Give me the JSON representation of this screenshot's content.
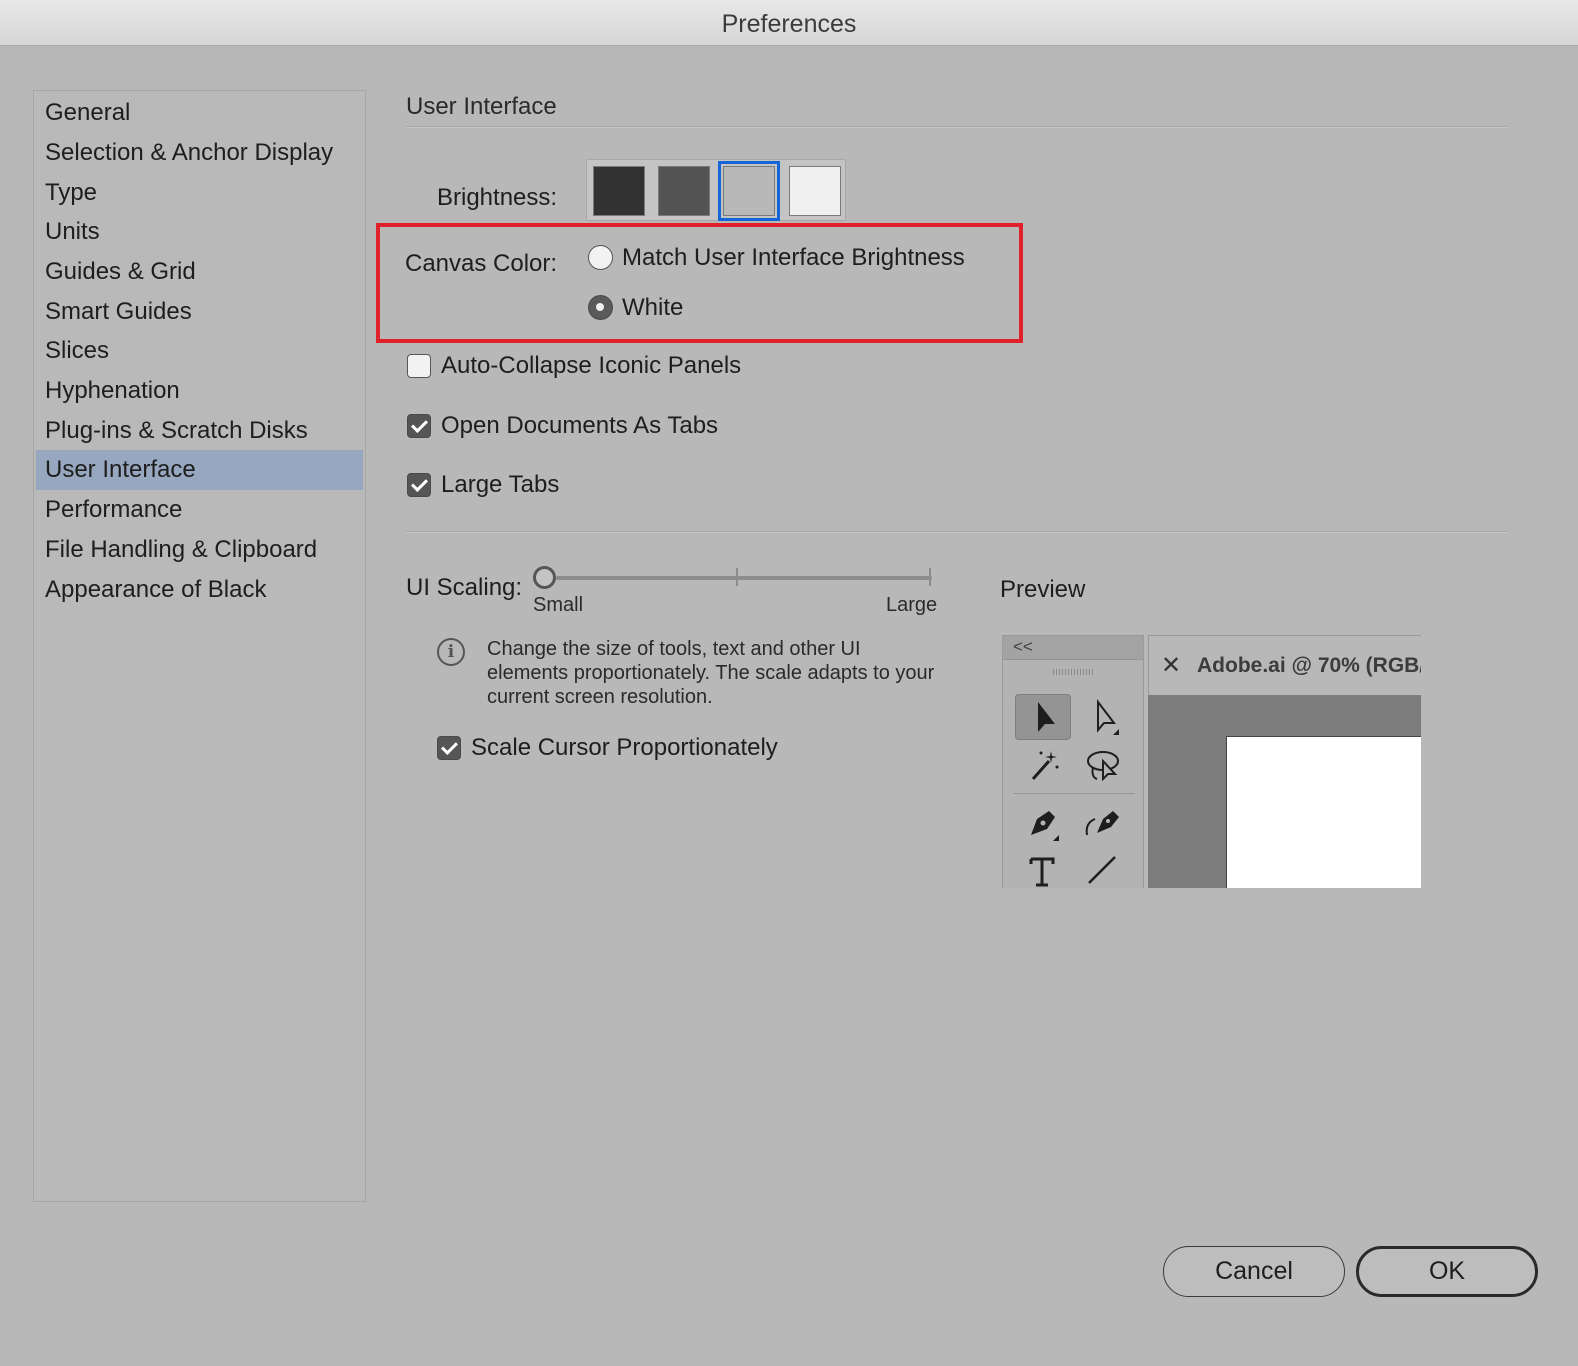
{
  "window": {
    "title": "Preferences"
  },
  "sidebar": {
    "items": [
      {
        "label": "General"
      },
      {
        "label": "Selection & Anchor Display"
      },
      {
        "label": "Type"
      },
      {
        "label": "Units"
      },
      {
        "label": "Guides & Grid"
      },
      {
        "label": "Smart Guides"
      },
      {
        "label": "Slices"
      },
      {
        "label": "Hyphenation"
      },
      {
        "label": "Plug-ins & Scratch Disks"
      },
      {
        "label": "User Interface",
        "selected": true
      },
      {
        "label": "Performance"
      },
      {
        "label": "File Handling & Clipboard"
      },
      {
        "label": "Appearance of Black"
      }
    ]
  },
  "main": {
    "section_title": "User Interface",
    "brightness": {
      "label": "Brightness:",
      "swatches": [
        {
          "color": "#323232"
        },
        {
          "color": "#535353"
        },
        {
          "color": "#b8b8b8",
          "selected": true
        },
        {
          "color": "#f0f0f0"
        }
      ]
    },
    "canvas_color": {
      "label": "Canvas Color:",
      "options": [
        {
          "label": "Match User Interface Brightness",
          "checked": false
        },
        {
          "label": "White",
          "checked": true
        }
      ]
    },
    "checkboxes": {
      "auto_collapse": {
        "label": "Auto-Collapse Iconic Panels",
        "checked": false
      },
      "open_as_tabs": {
        "label": "Open Documents As Tabs",
        "checked": true
      },
      "large_tabs": {
        "label": "Large Tabs",
        "checked": true
      },
      "scale_cursor": {
        "label": "Scale Cursor Proportionately",
        "checked": true
      }
    },
    "ui_scaling": {
      "label": "UI Scaling:",
      "min_label": "Small",
      "max_label": "Large",
      "value": 0,
      "info": "Change the size of tools, text and other UI elements proportionately. The scale adapts to your current screen resolution."
    },
    "preview": {
      "label": "Preview",
      "collapse_glyph": "<<",
      "close_glyph": "✕",
      "doc_title": "Adobe.ai @ 70% (RGB/"
    }
  },
  "buttons": {
    "cancel": "Cancel",
    "ok": "OK"
  },
  "colors": {
    "highlight": "#e0202a",
    "selected_item": "#96a7bf",
    "swatch_focus": "#1565d8"
  }
}
